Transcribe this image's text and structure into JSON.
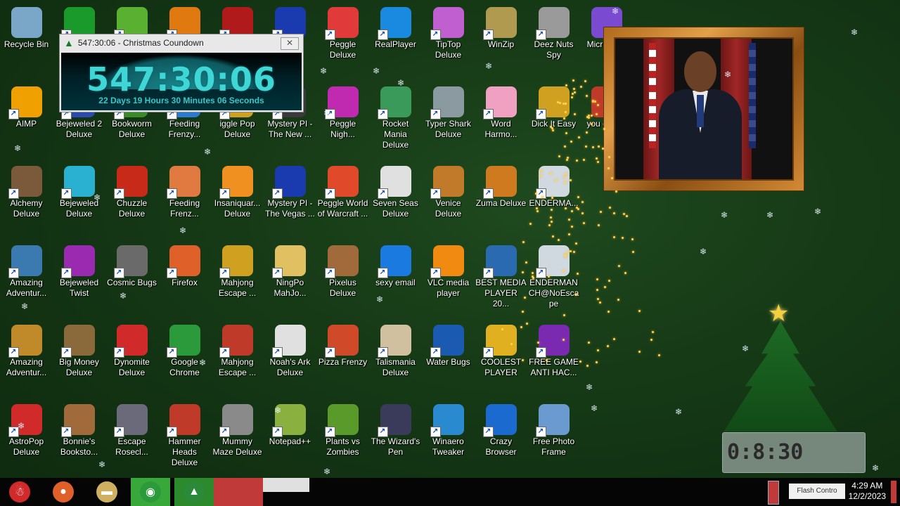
{
  "countdown": {
    "title": "547:30:06 - Christmas Coundown",
    "time": "547:30:06",
    "subtitle": "22 Days 19 Hours 30 Minutes 06 Seconds"
  },
  "tray": {
    "time": "4:29 AM",
    "date": "12/2/2023"
  },
  "colors": {
    "desktop": "#163a16",
    "countdown_text": "#3fd6d6",
    "frame": "#c4822f"
  },
  "columns": [
    [
      {
        "label": "Recycle Bin",
        "icon": "recycle-bin-icon",
        "color": "#7aa6c8"
      },
      {
        "label": "AIMP",
        "icon": "aimp-icon",
        "color": "#f0a000"
      },
      {
        "label": "Alchemy Deluxe",
        "icon": "alchemy-icon",
        "color": "#7a5a3a"
      },
      {
        "label": "Amazing Adventur...",
        "icon": "amazing-adventures-icon",
        "color": "#3a7ab0"
      },
      {
        "label": "Amazing Adventur...",
        "icon": "amazing-adventures-2-icon",
        "color": "#c08a2a"
      },
      {
        "label": "AstroPop Deluxe",
        "icon": "astropop-icon",
        "color": "#d02a2a"
      }
    ],
    [
      {
        "label": "",
        "icon": "radiation-icon",
        "color": "#1a9a2a"
      },
      {
        "label": "Bejeweled 2 Deluxe",
        "icon": "bejeweled-2-icon",
        "color": "#2a4ab0"
      },
      {
        "label": "Bejeweled Deluxe",
        "icon": "bejeweled-icon",
        "color": "#2ab0d0"
      },
      {
        "label": "Bejeweled Twist",
        "icon": "bejeweled-twist-icon",
        "color": "#9a2ab0"
      },
      {
        "label": "Big Money Deluxe",
        "icon": "big-money-icon",
        "color": "#8a6a3a"
      },
      {
        "label": "Bonnie's Booksto...",
        "icon": "bonnies-bookstore-icon",
        "color": "#a06a3a"
      }
    ],
    [
      {
        "label": "",
        "icon": "frog-icon",
        "color": "#5ab030"
      },
      {
        "label": "Bookworm Deluxe",
        "icon": "bookworm-icon",
        "color": "#3a8a2a"
      },
      {
        "label": "Chuzzle Deluxe",
        "icon": "chuzzle-icon",
        "color": "#c82a1a"
      },
      {
        "label": "Cosmic Bugs",
        "icon": "cosmic-bugs-icon",
        "color": "#6a6a6a"
      },
      {
        "label": "Dynomite Deluxe",
        "icon": "dynomite-icon",
        "color": "#d02a2a"
      },
      {
        "label": "Escape Rosecl...",
        "icon": "escape-rosecliff-icon",
        "color": "#6a6a7a"
      }
    ],
    [
      {
        "label": "",
        "icon": "ring-icon",
        "color": "#e07a10"
      },
      {
        "label": "Feeding Frenzy...",
        "icon": "feeding-frenzy-icon",
        "color": "#2a7ad0"
      },
      {
        "label": "Feeding Frenz...",
        "icon": "feeding-frenzy-2-icon",
        "color": "#e07a40"
      },
      {
        "label": "Firefox",
        "icon": "firefox-icon",
        "color": "#e0602a"
      },
      {
        "label": "Google Chrome",
        "icon": "chrome-icon",
        "color": "#2a9a3a"
      },
      {
        "label": "Hammer Heads Deluxe",
        "icon": "hammer-heads-icon",
        "color": "#c03a2a"
      }
    ],
    [
      {
        "label": "",
        "icon": "nuclear-icon",
        "color": "#b01a1a"
      },
      {
        "label": "iggle Pop Deluxe",
        "icon": "iggle-pop-icon",
        "color": "#d0a020"
      },
      {
        "label": "Insaniquar... Deluxe",
        "icon": "insaniquarium-icon",
        "color": "#f09020"
      },
      {
        "label": "Mahjong Escape ...",
        "icon": "mahjong-escape-icon",
        "color": "#d0a020"
      },
      {
        "label": "Mahjong Escape ...",
        "icon": "mahjong-escape-2-icon",
        "color": "#c03a2a"
      },
      {
        "label": "Mummy Maze Deluxe",
        "icon": "mummy-maze-icon",
        "color": "#8a8a8a"
      }
    ],
    [
      {
        "label": "",
        "icon": "mystery-pi-icon",
        "color": "#1a3ab0"
      },
      {
        "label": "Mystery PI - The New ...",
        "icon": "mystery-pi-new-york-icon",
        "color": "#3a3a3a"
      },
      {
        "label": "Mystery PI - The Vegas ...",
        "icon": "mystery-pi-vegas-icon",
        "color": "#1a3ab0"
      },
      {
        "label": "NingPo MahJo...",
        "icon": "ningpo-icon",
        "color": "#e0c060"
      },
      {
        "label": "Noah's Ark Deluxe",
        "icon": "noahs-ark-icon",
        "color": "#e0e0e0"
      },
      {
        "label": "Notepad++",
        "icon": "notepad-plus-icon",
        "color": "#8ab040"
      }
    ],
    [
      {
        "label": "Peggle Deluxe",
        "icon": "peggle-icon",
        "color": "#e03a3a"
      },
      {
        "label": "Peggle Nigh...",
        "icon": "peggle-nights-icon",
        "color": "#c02ab0"
      },
      {
        "label": "Peggle World of Warcraft ...",
        "icon": "peggle-wow-icon",
        "color": "#e04a2a"
      },
      {
        "label": "Pixelus Deluxe",
        "icon": "pixelus-icon",
        "color": "#a06a3a"
      },
      {
        "label": "Pizza Frenzy",
        "icon": "pizza-frenzy-icon",
        "color": "#d04a2a"
      },
      {
        "label": "Plants vs Zombies",
        "icon": "plants-vs-zombies-icon",
        "color": "#5a9a2a"
      }
    ],
    [
      {
        "label": "RealPlayer",
        "icon": "realplayer-icon",
        "color": "#1a8ae0"
      },
      {
        "label": "Rocket Mania Deluxe",
        "icon": "rocket-mania-icon",
        "color": "#3a9a5a"
      },
      {
        "label": "Seven Seas Deluxe",
        "icon": "seven-seas-icon",
        "color": "#e0e0e0"
      },
      {
        "label": "sexy email",
        "icon": "email-icon",
        "color": "#1a7ae0"
      },
      {
        "label": "Talismania Deluxe",
        "icon": "talismania-icon",
        "color": "#d0c0a0"
      },
      {
        "label": "The Wizard's Pen",
        "icon": "wizards-pen-icon",
        "color": "#3a3a5a"
      }
    ],
    [
      {
        "label": "TipTop Deluxe",
        "icon": "tiptop-icon",
        "color": "#c060d0"
      },
      {
        "label": "Typer Shark Deluxe",
        "icon": "typer-shark-icon",
        "color": "#8a9aa0"
      },
      {
        "label": "Venice Deluxe",
        "icon": "venice-icon",
        "color": "#c07a2a"
      },
      {
        "label": "VLC media player",
        "icon": "vlc-icon",
        "color": "#f08a10"
      },
      {
        "label": "Water Bugs",
        "icon": "water-bugs-icon",
        "color": "#1a5ab0"
      },
      {
        "label": "Winaero Tweaker",
        "icon": "winaero-tweaker-icon",
        "color": "#2a8ad0"
      }
    ],
    [
      {
        "label": "WinZip",
        "icon": "winzip-icon",
        "color": "#b09a50"
      },
      {
        "label": "Word Harmo...",
        "icon": "word-harmony-icon",
        "color": "#f0a0c0"
      },
      {
        "label": "Zuma Deluxe",
        "icon": "zuma-icon",
        "color": "#d07a20"
      },
      {
        "label": "BEST MEDIA PLAYER 20...",
        "icon": "xmplay-icon",
        "color": "#2a6ab0"
      },
      {
        "label": "COOLEST PLAYER",
        "icon": "coolest-player-icon",
        "color": "#e0b020"
      },
      {
        "label": "Crazy Browser",
        "icon": "crazy-browser-icon",
        "color": "#1a6ad0"
      }
    ],
    [
      {
        "label": "Deez Nuts Spy",
        "icon": "deez-nuts-spy-icon",
        "color": "#9a9a9a"
      },
      {
        "label": "Dick It Easy",
        "icon": "dick-it-easy-icon",
        "color": "#d0a020"
      },
      {
        "label": "ENDERMA...",
        "icon": "enderman-icon",
        "color": "#d0d8e0"
      },
      {
        "label": "ENDERMAN CH@NoEsca pe",
        "icon": "enderman-noescape-icon",
        "color": "#d0d8e0"
      },
      {
        "label": "FREE GAME ANTI HAC...",
        "icon": "free-game-anti-hack-icon",
        "color": "#7a2ab0"
      },
      {
        "label": "Free Photo Frame",
        "icon": "free-photo-frame-icon",
        "color": "#6a9ad0"
      }
    ]
  ],
  "partial_icons": [
    {
      "label": "Micr Visua",
      "icon": "visual-studio-icon",
      "color": "#7a4ad0"
    },
    {
      "label": "you d dont",
      "icon": "mystery-icon",
      "color": "#c03a2a"
    }
  ],
  "taskbar": [
    {
      "name": "santa-start-icon",
      "color": "#d02a2a",
      "glyph": "☃"
    },
    {
      "name": "firefox-taskbar-icon",
      "color": "#e0602a",
      "glyph": "●"
    },
    {
      "name": "file-explorer-taskbar-icon",
      "color": "#d0b060",
      "glyph": "▬"
    },
    {
      "name": "chrome-taskbar-icon",
      "color": "#2a9a3a",
      "glyph": "◉"
    },
    {
      "name": "christmas-tree-taskbar-icon",
      "color": "#2a8a3a",
      "glyph": "▲"
    }
  ],
  "tray_labels": {
    "control": "Flash Contro"
  }
}
